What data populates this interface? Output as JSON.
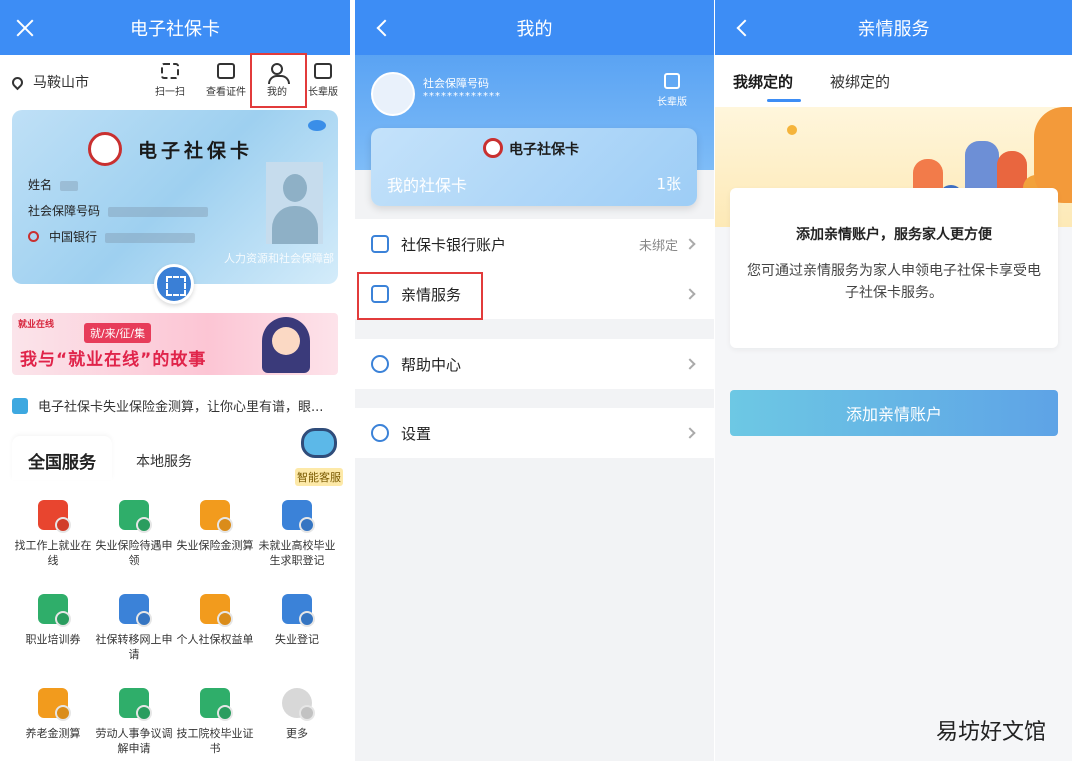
{
  "screen1": {
    "nav_title": "电子社保卡",
    "location": "马鞍山市",
    "tools": [
      {
        "label": "扫一扫"
      },
      {
        "label": "查看证件"
      },
      {
        "label": "我的"
      },
      {
        "label": "长辈版"
      }
    ],
    "card": {
      "title": "电子社保卡",
      "name_label": "姓名",
      "ssn_label": "社会保障号码",
      "bank_label": "中国银行",
      "department": "人力资源和社会保障部"
    },
    "banner": {
      "brand": "就业在线",
      "tag": "就/来/征/集",
      "headline": "我与“就业在线”的故事"
    },
    "notice": "电子社保卡失业保险金测算，让你心里有谱，眼...",
    "service_tabs": {
      "national": "全国服务",
      "local": "本地服务"
    },
    "assistant_label": "智能客服",
    "services": [
      {
        "label": "找工作上就业在线",
        "color": "#e8452f"
      },
      {
        "label": "失业保险待遇申领",
        "color": "#2fae6a"
      },
      {
        "label": "失业保险金测算",
        "color": "#f29b1d"
      },
      {
        "label": "未就业高校毕业生求职登记",
        "color": "#3b82d8"
      },
      {
        "label": "职业培训券",
        "color": "#2fae6a"
      },
      {
        "label": "社保转移网上申请",
        "color": "#3b82d8"
      },
      {
        "label": "个人社保权益单",
        "color": "#f29b1d"
      },
      {
        "label": "失业登记",
        "color": "#3b82d8"
      },
      {
        "label": "养老金测算",
        "color": "#f29b1d"
      },
      {
        "label": "劳动人事争议调解申请",
        "color": "#2fae6a"
      },
      {
        "label": "技工院校毕业证书",
        "color": "#2fae6a"
      },
      {
        "label": "更多",
        "color": "#d8d8d8"
      }
    ]
  },
  "screen2": {
    "nav_title": "我的",
    "ssn_label": "社会保障号码",
    "ssn_value": "*************",
    "elder_mode": "长辈版",
    "card": {
      "name": "电子社保卡",
      "label": "我的社保卡",
      "count": "1张"
    },
    "menu": [
      {
        "label": "社保卡银行账户",
        "value": "未绑定"
      },
      {
        "label": "亲情服务",
        "value": ""
      },
      {
        "label": "帮助中心",
        "value": ""
      },
      {
        "label": "设置",
        "value": ""
      }
    ]
  },
  "screen3": {
    "nav_title": "亲情服务",
    "tabs": [
      {
        "label": "我绑定的"
      },
      {
        "label": "被绑定的"
      }
    ],
    "info_title": "添加亲情账户，服务家人更方便",
    "info_desc": "您可通过亲情服务为家人申领电子社保卡享受电子社保卡服务。",
    "add_button": "添加亲情账户"
  },
  "watermark": "易坊好文馆",
  "colors": {
    "primary": "#3d8df5",
    "highlight": "#e23b3b"
  }
}
